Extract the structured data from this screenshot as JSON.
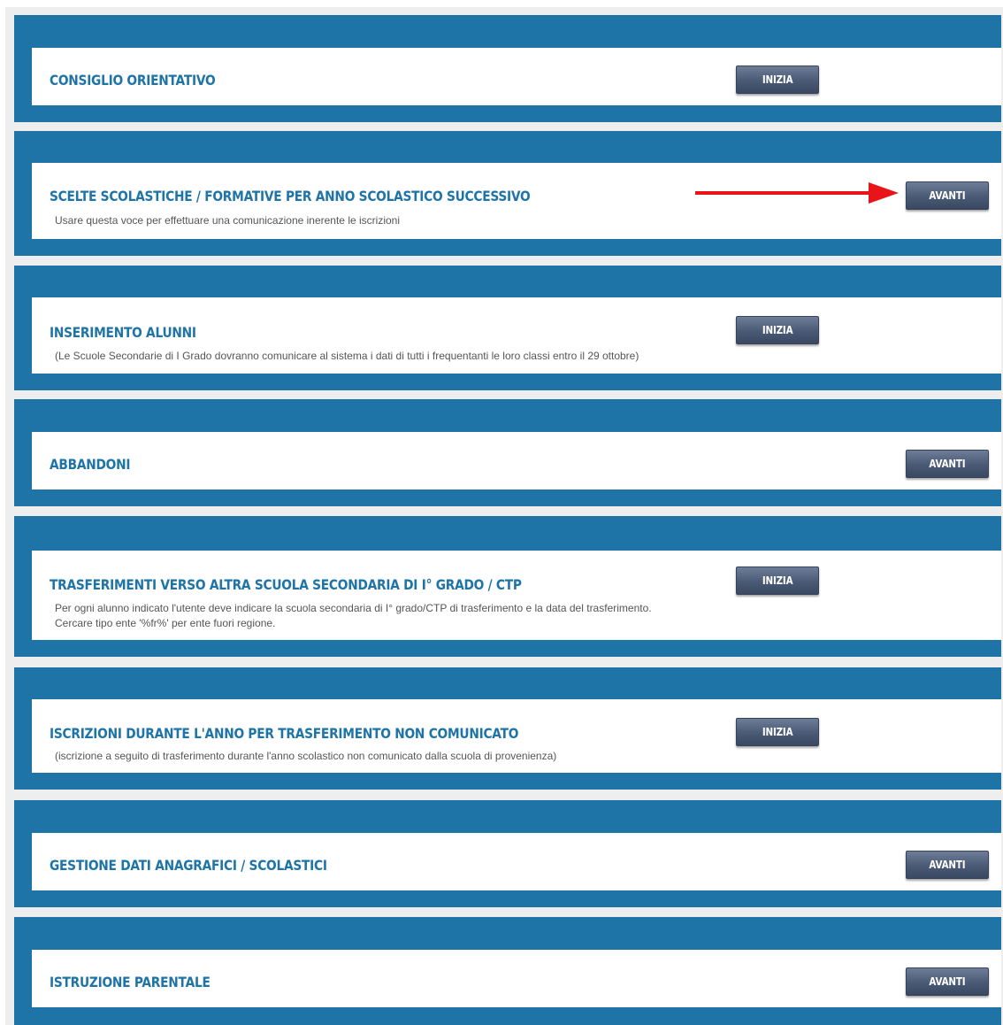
{
  "sections": [
    {
      "title": "CONSIGLIO ORIENTATIVO",
      "description": "",
      "description2": "",
      "button": "INIZIA"
    },
    {
      "title": "SCELTE SCOLASTICHE / FORMATIVE PER ANNO SCOLASTICO SUCCESSIVO",
      "description": "Usare questa voce per effettuare una comunicazione inerente le iscrizioni",
      "description2": "",
      "button": "AVANTI"
    },
    {
      "title": "INSERIMENTO ALUNNI",
      "description": "(Le Scuole Secondarie di I Grado dovranno comunicare al sistema i dati di tutti i frequentanti le loro classi entro il 29 ottobre)",
      "description2": "",
      "button": "INIZIA"
    },
    {
      "title": "ABBANDONI",
      "description": "",
      "description2": "",
      "button": "AVANTI"
    },
    {
      "title": "TRASFERIMENTI VERSO ALTRA SCUOLA SECONDARIA DI I° GRADO / CTP",
      "description": "Per ogni alunno indicato l'utente deve indicare la scuola secondaria di I° grado/CTP di trasferimento e la data del trasferimento.",
      "description2": "Cercare tipo ente '%fr%' per ente fuori regione.",
      "button": "INIZIA"
    },
    {
      "title": "ISCRIZIONI DURANTE L'ANNO PER TRASFERIMENTO NON COMUNICATO",
      "description": "(iscrizione a seguito di trasferimento durante l'anno scolastico non comunicato dalla scuola di provenienza)",
      "description2": "",
      "button": "INIZIA"
    },
    {
      "title": "GESTIONE DATI ANAGRAFICI / SCOLASTICI",
      "description": "",
      "description2": "",
      "button": "AVANTI"
    },
    {
      "title": "ISTRUZIONE PARENTALE",
      "description": "",
      "description2": "",
      "button": "AVANTI"
    }
  ],
  "colors": {
    "section_bg": "#1f74a7",
    "title": "#1f74a7",
    "button": "#4a5a75",
    "arrow": "#e8141a"
  },
  "annotation": {
    "icon": "red-arrow-icon",
    "points_to": "sections.1.button"
  }
}
